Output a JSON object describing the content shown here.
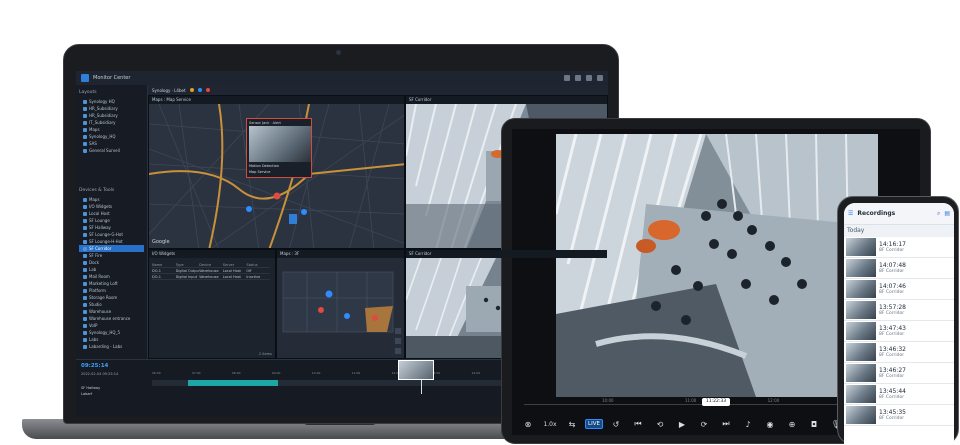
{
  "laptop": {
    "app_title": "Monitor Center",
    "tab_label": "Synology · L4bet",
    "sidebar": {
      "layouts_heading": "Layouts",
      "layouts": [
        "Synology HQ",
        "HR_Subsidiary",
        "HR_Subsidiary",
        "IT_Subsidiary",
        "Maps",
        "Synology_HQ",
        "SAS",
        "General Surveil"
      ],
      "devices_heading": "Devices & Tools",
      "devices": [
        "Maps",
        "I/O Widgets",
        "Local Host",
        "SF Lounge",
        "SF Hallway",
        "SF Lounge-G-Hot",
        "SF Lounge-H-Hot",
        "SF Corridor",
        "SF Fire",
        "Dock",
        "Lab",
        "Mail Room",
        "Marketing Loft",
        "Platform",
        "Storage Room",
        "Studio",
        "Warehouse",
        "Warehouse entrance",
        "VoIP",
        "Synology_HQ_5",
        "Labs",
        "Labarding - Labs"
      ],
      "selected_index": 7
    },
    "panes": {
      "map_title": "Maps : Map Service",
      "popup_title": "Sensor Jack · Alert",
      "popup_line1": "Motion Detection",
      "popup_line2": "Map Service",
      "google_mark": "Google",
      "camera1_title": "SF Corridor",
      "io_title": "I/O Widgets",
      "io_headers": [
        "Name",
        "Type",
        "Device",
        "Server",
        "Status"
      ],
      "io_rows": [
        [
          "DO-1",
          "Digital Output",
          "Warehouse",
          "Local Host",
          "Off"
        ],
        [
          "DO-1",
          "Digital Input",
          "Warehouse",
          "Local Host",
          "Inactive"
        ]
      ],
      "io_footer": "2 items",
      "floor_title": "Maps : 3F",
      "camera2_title": "SF Corridor"
    },
    "timeline": {
      "time": "09:25:14",
      "date": "2022-02-04 09:25:14",
      "camera_label": "SF Hallway",
      "camera_label2": "Labarf",
      "ruler": [
        "06:00",
        "07:00",
        "08:00",
        "09:00",
        "10:00",
        "11:00",
        "12:00",
        "13:00",
        "14:00",
        "15:00",
        "16:00",
        "17:00"
      ]
    }
  },
  "tablet": {
    "scrub_ticks": [
      "10:00",
      "11:00",
      "12:00",
      "13:00"
    ],
    "scrub_badge": "11:22:33",
    "controls": {
      "speed": "1.0x",
      "live": "LIVE",
      "hd": "HD"
    }
  },
  "phone": {
    "title": "Recordings",
    "day": "Today",
    "recordings": [
      {
        "time": "14:16:17",
        "camera": "8F Corridor"
      },
      {
        "time": "14:07:48",
        "camera": "8F Corridor"
      },
      {
        "time": "14:07:46",
        "camera": "8F Corridor"
      },
      {
        "time": "13:57:28",
        "camera": "8F Corridor"
      },
      {
        "time": "13:47:43",
        "camera": "8F Corridor"
      },
      {
        "time": "13:46:32",
        "camera": "8F Corridor"
      },
      {
        "time": "13:46:27",
        "camera": "8F Corridor"
      },
      {
        "time": "13:45:44",
        "camera": "8F Corridor"
      },
      {
        "time": "13:45:35",
        "camera": "8F Corridor"
      }
    ]
  }
}
